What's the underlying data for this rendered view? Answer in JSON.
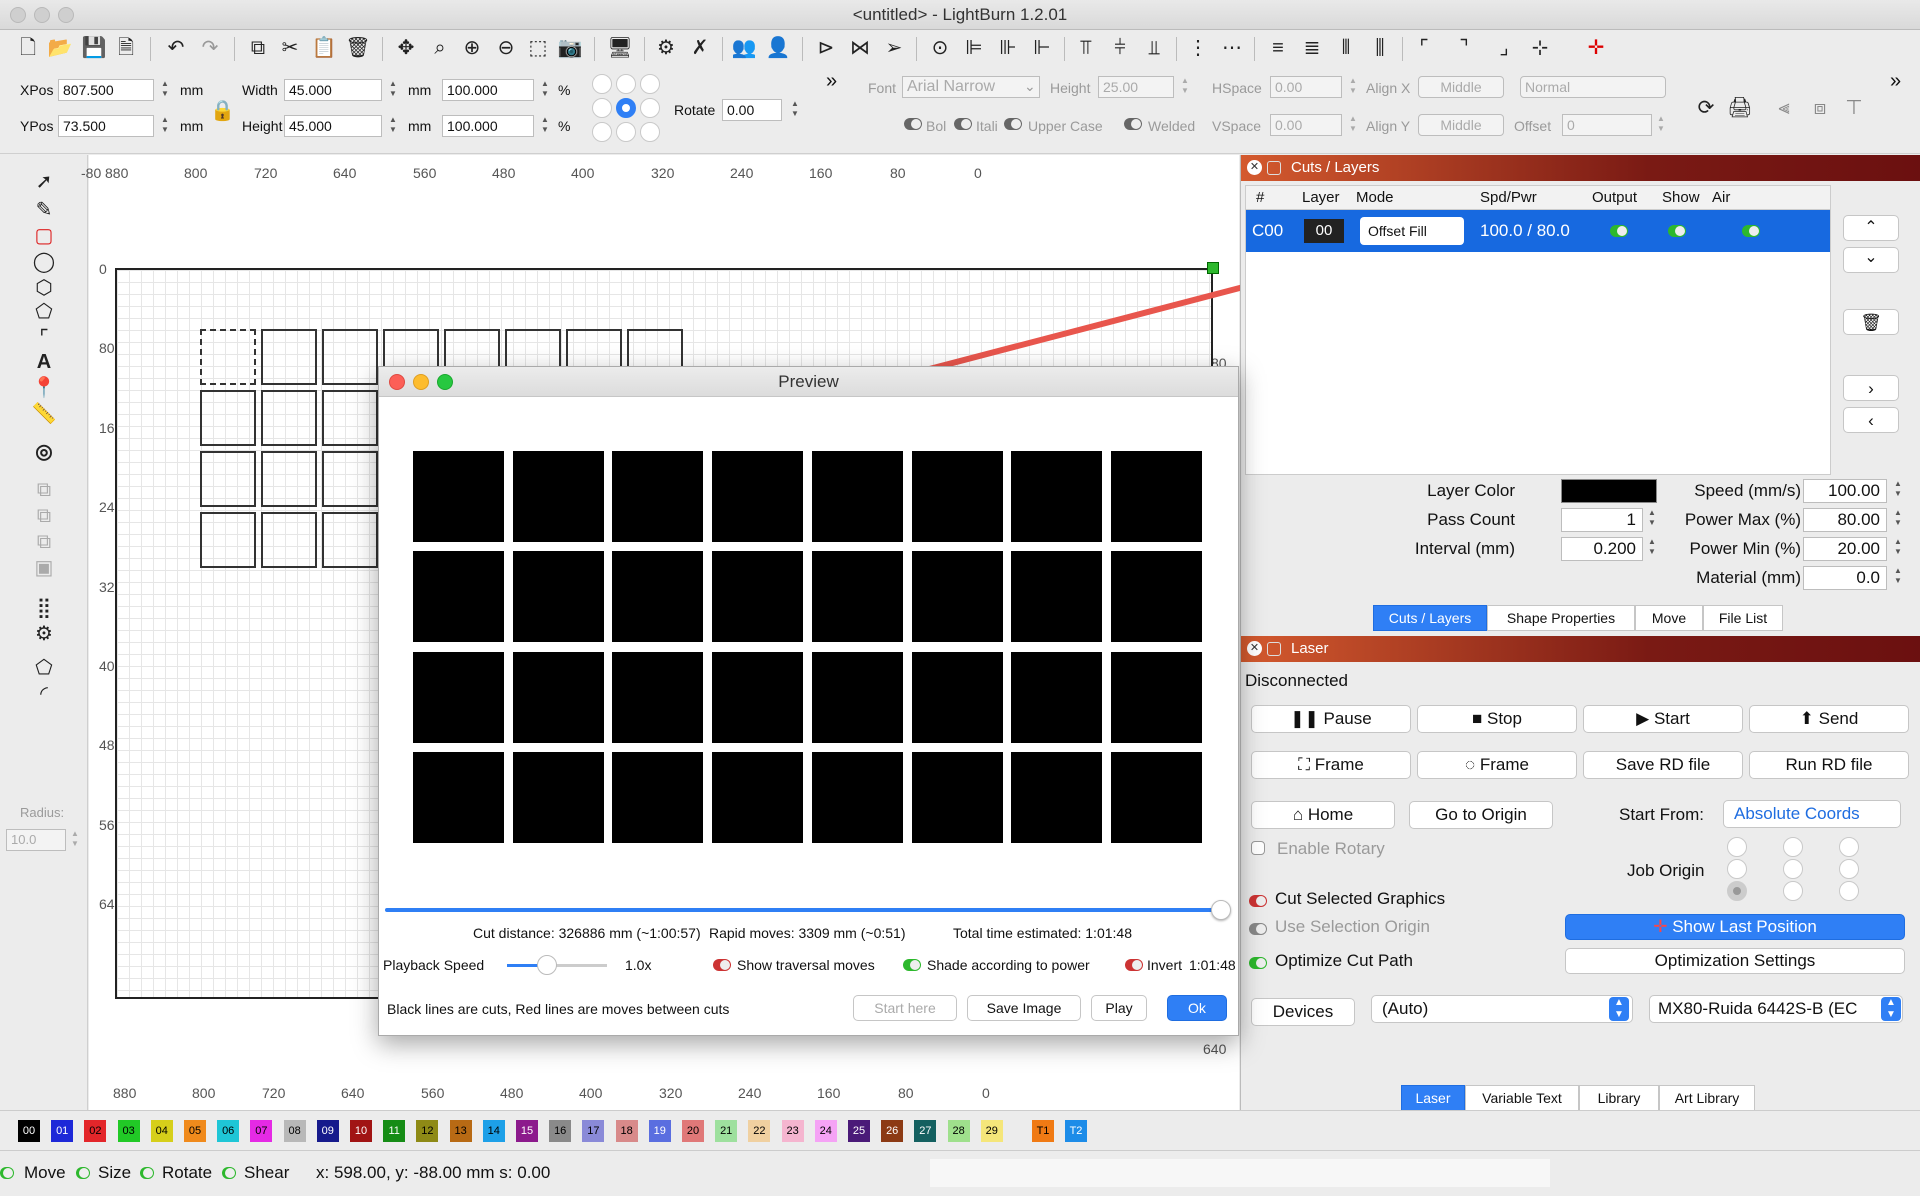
{
  "window": {
    "title": "<untitled> - LightBurn 1.2.01"
  },
  "toolbar2": {
    "xpos_label": "XPos",
    "xpos_value": "807.500",
    "ypos_label": "YPos",
    "ypos_value": "73.500",
    "mm": "mm",
    "pct": "%",
    "width_label": "Width",
    "width_value": "45.000",
    "height_label": "Height",
    "height_value": "45.000",
    "wpct": "100.000",
    "hpct": "100.000",
    "rotate_label": "Rotate",
    "rotate_value": "0.00",
    "font_label": "Font",
    "font_value": "Arial Narrow",
    "fheight_label": "Height",
    "fheight_value": "25.00",
    "hspace_label": "HSpace",
    "hspace_value": "0.00",
    "vspace_label": "VSpace",
    "vspace_value": "0.00",
    "alignx_label": "Align X",
    "alignx_value": "Middle",
    "aligny_label": "Align Y",
    "aligny_value": "Middle",
    "normal_value": "Normal",
    "offset_label": "Offset",
    "offset_value": "0",
    "bold": "Bol",
    "italic": "Itali",
    "upper": "Upper Case",
    "welded": "Welded"
  },
  "lefttools": {
    "radius_label": "Radius:",
    "radius_value": "10.0"
  },
  "canvas": {
    "top_ticks": [
      "-80",
      "880",
      "800",
      "720",
      "640",
      "560",
      "480",
      "400",
      "320",
      "240",
      "160",
      "80",
      "0"
    ],
    "bottom_ticks": [
      "880",
      "800",
      "720",
      "640",
      "560",
      "480",
      "400",
      "320",
      "240",
      "160",
      "80",
      "0"
    ],
    "left_ticks": [
      "0",
      "80",
      "160",
      "240",
      "320",
      "400",
      "480",
      "560",
      "640"
    ],
    "right_ticks": [
      "0",
      "80",
      "640"
    ]
  },
  "preview": {
    "title": "Preview",
    "cut_distance": "Cut distance: 326886 mm (~1:00:57)",
    "rapid": "Rapid moves: 3309 mm (~0:51)",
    "total": "Total time estimated: 1:01:48",
    "playback_label": "Playback Speed",
    "playback_value": "1.0x",
    "show_traversal": "Show traversal moves",
    "shade": "Shade according to power",
    "invert": "Invert",
    "invert_time": "1:01:48",
    "note": "Black lines are cuts, Red lines are moves between cuts",
    "start_here": "Start here",
    "save_image": "Save Image",
    "play": "Play",
    "ok": "Ok"
  },
  "cuts": {
    "panel_title": "Cuts / Layers",
    "headers": {
      "num": "#",
      "layer": "Layer",
      "mode": "Mode",
      "spd": "Spd/Pwr",
      "output": "Output",
      "show": "Show",
      "air": "Air"
    },
    "row": {
      "num": "C00",
      "layer": "00",
      "mode": "Offset Fill",
      "spd": "100.0 / 80.0"
    },
    "layer_color_label": "Layer Color",
    "layer_color": "#000000",
    "speed_label": "Speed (mm/s)",
    "speed": "100.00",
    "pass_label": "Pass Count",
    "pass": "1",
    "pmax_label": "Power Max (%)",
    "pmax": "80.00",
    "interval_label": "Interval (mm)",
    "interval": "0.200",
    "pmin_label": "Power Min (%)",
    "pmin": "20.00",
    "material_label": "Material (mm)",
    "material": "0.0",
    "tabs": [
      "Cuts / Layers",
      "Shape Properties",
      "Move",
      "File List"
    ]
  },
  "laser": {
    "panel_title": "Laser",
    "status": "Disconnected",
    "pause": "Pause",
    "stop": "Stop",
    "start": "Start",
    "send": "Send",
    "frame1": "Frame",
    "frame2": "Frame",
    "save_rd": "Save RD file",
    "run_rd": "Run RD file",
    "home": "Home",
    "go_origin": "Go to Origin",
    "start_from_label": "Start From:",
    "start_from_value": "Absolute Coords",
    "enable_rotary": "Enable Rotary",
    "job_origin": "Job Origin",
    "cut_selected": "Cut Selected Graphics",
    "use_sel_origin": "Use Selection Origin",
    "show_last": "Show Last Position",
    "optimize": "Optimize Cut Path",
    "opt_settings": "Optimization Settings",
    "devices": "Devices",
    "auto": "(Auto)",
    "device_name": "MX80-Ruida 6442S-B (EC",
    "tabs": [
      "Laser",
      "Variable Text",
      "Library",
      "Art Library"
    ]
  },
  "palette": [
    {
      "t": "00",
      "c": "#000000",
      "f": "#ffffff"
    },
    {
      "t": "01",
      "c": "#1d28d8",
      "f": "#ffffff"
    },
    {
      "t": "02",
      "c": "#e3262a",
      "f": "#000000"
    },
    {
      "t": "03",
      "c": "#21c926",
      "f": "#000000"
    },
    {
      "t": "04",
      "c": "#d6cf1a",
      "f": "#000000"
    },
    {
      "t": "05",
      "c": "#f08a1c",
      "f": "#000000"
    },
    {
      "t": "06",
      "c": "#1fc6d6",
      "f": "#000000"
    },
    {
      "t": "07",
      "c": "#e52ae5",
      "f": "#000000"
    },
    {
      "t": "08",
      "c": "#b8b8b8",
      "f": "#000000"
    },
    {
      "t": "09",
      "c": "#161a8c",
      "f": "#ffffff"
    },
    {
      "t": "10",
      "c": "#a11414",
      "f": "#ffffff"
    },
    {
      "t": "11",
      "c": "#168c16",
      "f": "#ffffff"
    },
    {
      "t": "12",
      "c": "#8e8a16",
      "f": "#000000"
    },
    {
      "t": "13",
      "c": "#b86a14",
      "f": "#000000"
    },
    {
      "t": "14",
      "c": "#1da0e8",
      "f": "#000000"
    },
    {
      "t": "15",
      "c": "#8c1a8c",
      "f": "#ffffff"
    },
    {
      "t": "16",
      "c": "#8a8a8a",
      "f": "#000000"
    },
    {
      "t": "17",
      "c": "#8a8ad8",
      "f": "#000000"
    },
    {
      "t": "18",
      "c": "#d88a8a",
      "f": "#000000"
    },
    {
      "t": "19",
      "c": "#5a6ee0",
      "f": "#ffffff"
    },
    {
      "t": "20",
      "c": "#e07878",
      "f": "#000000"
    },
    {
      "t": "21",
      "c": "#9ee09e",
      "f": "#000000"
    },
    {
      "t": "22",
      "c": "#f0d0a0",
      "f": "#000000"
    },
    {
      "t": "23",
      "c": "#f5b5cf",
      "f": "#000000"
    },
    {
      "t": "24",
      "c": "#f5a3f5",
      "f": "#000000"
    },
    {
      "t": "25",
      "c": "#4a1a78",
      "f": "#ffffff"
    },
    {
      "t": "26",
      "c": "#8c3a14",
      "f": "#ffffff"
    },
    {
      "t": "27",
      "c": "#146060",
      "f": "#ffffff"
    },
    {
      "t": "28",
      "c": "#9fe08c",
      "f": "#000000"
    },
    {
      "t": "29",
      "c": "#f5e67a",
      "f": "#000000"
    },
    {
      "t": "T1",
      "c": "#f07a14",
      "f": "#000000"
    },
    {
      "t": "T2",
      "c": "#1d8ce8",
      "f": "#ffffff"
    }
  ],
  "status": {
    "move": "Move",
    "size": "Size",
    "rotate": "Rotate",
    "shear": "Shear",
    "coords": "x: 598.00, y: -88.00 mm  s: 0.00"
  },
  "colors": {
    "accent": "#2f7ff5",
    "selected_row": "#1769e0",
    "arrow": "#e8564d"
  },
  "icons": [
    "new-file-icon",
    "open-icon",
    "save-icon",
    "save-as-icon",
    "undo-icon",
    "redo-icon",
    "copy-icon",
    "cut-icon",
    "paste-icon",
    "delete-icon",
    "move-icon",
    "zoom-icon",
    "zoom-in-icon",
    "zoom-out-icon",
    "frame-select-icon",
    "camera-icon",
    "monitor-icon",
    "settings-icon",
    "tools-icon",
    "users-icon",
    "user-icon",
    "flip-icon",
    "mirror-icon",
    "send-icon",
    "target-icon",
    "align-icon"
  ]
}
